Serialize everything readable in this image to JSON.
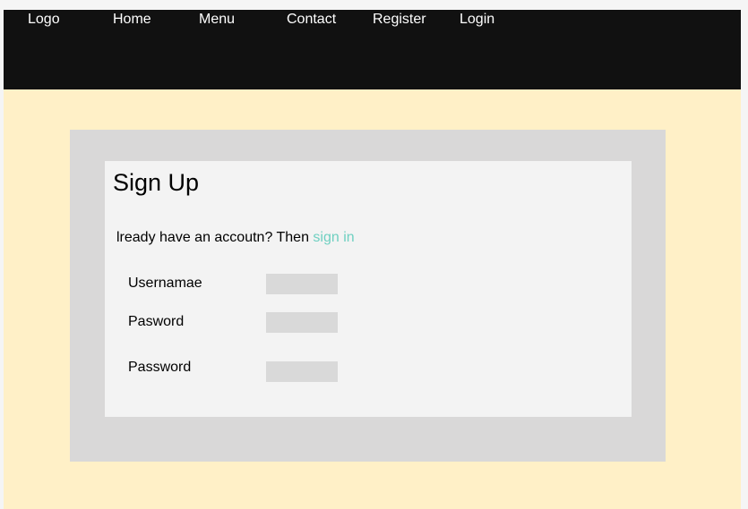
{
  "nav": {
    "logo": "Logo",
    "items": [
      {
        "label": "Home"
      },
      {
        "label": "Menu"
      },
      {
        "label": "Contact"
      },
      {
        "label": "Register"
      },
      {
        "label": "Login"
      }
    ]
  },
  "form": {
    "title": "Sign Up",
    "account_prompt": "lready have an accoutn? Then ",
    "signin_link": "sign in",
    "fields": [
      {
        "label": "Usernamae",
        "value": ""
      },
      {
        "label": "Pasword",
        "value": ""
      },
      {
        "label": "Password",
        "value": ""
      }
    ]
  },
  "colors": {
    "navbar": "#111111",
    "page_background": "#fff0c7",
    "outer_panel": "#d9d8d8",
    "card": "#f3f3f3",
    "link": "#6fd0c1",
    "input": "#d9d9d9"
  }
}
